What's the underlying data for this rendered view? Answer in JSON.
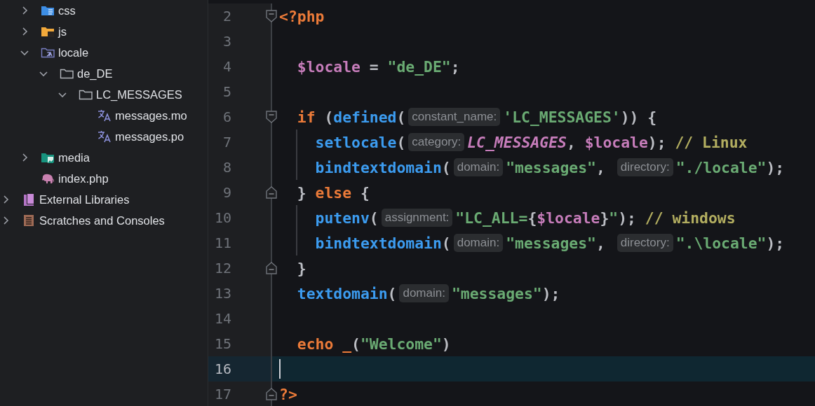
{
  "sidebar": {
    "project_items": [
      {
        "label": "css",
        "kind": "folder-css",
        "expanded": false
      },
      {
        "label": "js",
        "kind": "folder-js",
        "expanded": false
      },
      {
        "label": "locale",
        "kind": "folder-locale",
        "expanded": true,
        "children": [
          {
            "label": "de_DE",
            "kind": "folder",
            "expanded": true,
            "children": [
              {
                "label": "LC_MESSAGES",
                "kind": "folder",
                "expanded": true,
                "children": [
                  {
                    "label": "messages.mo",
                    "kind": "translation"
                  },
                  {
                    "label": "messages.po",
                    "kind": "translation"
                  }
                ]
              }
            ]
          }
        ]
      },
      {
        "label": "media",
        "kind": "folder-media",
        "expanded": false
      },
      {
        "label": "index.php",
        "kind": "php"
      }
    ],
    "roots": [
      {
        "label": "External Libraries",
        "kind": "libraries",
        "expanded": false
      },
      {
        "label": "Scratches and Consoles",
        "kind": "scratches",
        "expanded": false
      }
    ]
  },
  "editor": {
    "lines": [
      {
        "number": "2",
        "kind": "top",
        "fold_start": true,
        "fold_end": false,
        "current": false,
        "tokens": [
          {
            "kind": "keyword",
            "text": "<?php"
          }
        ]
      },
      {
        "number": "3",
        "kind": "top",
        "fold_start": false,
        "fold_end": false,
        "current": false
      },
      {
        "number": "4",
        "kind": "body",
        "fold_start": false,
        "fold_end": false,
        "current": false,
        "tokens": [
          {
            "kind": "variable",
            "text": "$locale"
          },
          {
            "kind": "punct",
            "text": " = "
          },
          {
            "kind": "string",
            "text": "\"de_DE\""
          },
          {
            "kind": "punct",
            "text": ";"
          }
        ]
      },
      {
        "number": "5",
        "kind": "top",
        "fold_start": false,
        "fold_end": false,
        "current": false
      },
      {
        "number": "6",
        "kind": "body",
        "fold_start": true,
        "fold_end": false,
        "current": false,
        "tokens": [
          {
            "kind": "keyword",
            "text": "if"
          },
          {
            "kind": "punct",
            "text": " ("
          },
          {
            "kind": "function",
            "text": "defined"
          },
          {
            "kind": "punct",
            "text": "("
          },
          {
            "kind": "hint",
            "text": "constant_name:"
          },
          {
            "kind": "string",
            "text": "'LC_MESSAGES'"
          },
          {
            "kind": "punct",
            "text": ")) {"
          }
        ]
      },
      {
        "number": "7",
        "kind": "block",
        "fold_start": false,
        "fold_end": false,
        "current": false,
        "tokens": [
          {
            "kind": "function",
            "text": "setlocale"
          },
          {
            "kind": "punct",
            "text": "("
          },
          {
            "kind": "hint",
            "text": "category:"
          },
          {
            "kind": "constant",
            "text": "LC_MESSAGES"
          },
          {
            "kind": "punct",
            "text": ", "
          },
          {
            "kind": "variable",
            "text": "$locale"
          },
          {
            "kind": "punct",
            "text": "); "
          },
          {
            "kind": "comment",
            "text": "// Linux"
          }
        ]
      },
      {
        "number": "8",
        "kind": "block",
        "fold_start": false,
        "fold_end": false,
        "current": false,
        "tokens": [
          {
            "kind": "function",
            "text": "bindtextdomain"
          },
          {
            "kind": "punct",
            "text": "("
          },
          {
            "kind": "hint",
            "text": "domain:"
          },
          {
            "kind": "string",
            "text": "\"messages\""
          },
          {
            "kind": "punct",
            "text": ", "
          },
          {
            "kind": "hint",
            "text": "directory:"
          },
          {
            "kind": "string",
            "text": "\"./locale\""
          },
          {
            "kind": "punct",
            "text": ");"
          }
        ]
      },
      {
        "number": "9",
        "kind": "body",
        "fold_start": false,
        "fold_end": true,
        "current": false,
        "tokens": [
          {
            "kind": "punct",
            "text": "} "
          },
          {
            "kind": "keyword",
            "text": "else"
          },
          {
            "kind": "punct",
            "text": " {"
          }
        ]
      },
      {
        "number": "10",
        "kind": "block",
        "fold_start": false,
        "fold_end": false,
        "current": false,
        "tokens": [
          {
            "kind": "function",
            "text": "putenv"
          },
          {
            "kind": "punct",
            "text": "("
          },
          {
            "kind": "hint",
            "text": "assignment:"
          },
          {
            "kind": "string",
            "text": "\"LC_ALL="
          },
          {
            "kind": "punct",
            "text": "{"
          },
          {
            "kind": "variable",
            "text": "$locale"
          },
          {
            "kind": "punct",
            "text": "}"
          },
          {
            "kind": "string",
            "text": "\""
          },
          {
            "kind": "punct",
            "text": "); "
          },
          {
            "kind": "comment",
            "text": "// windows"
          }
        ]
      },
      {
        "number": "11",
        "kind": "block",
        "fold_start": false,
        "fold_end": false,
        "current": false,
        "tokens": [
          {
            "kind": "function",
            "text": "bindtextdomain"
          },
          {
            "kind": "punct",
            "text": "("
          },
          {
            "kind": "hint",
            "text": "domain:"
          },
          {
            "kind": "string",
            "text": "\"messages\""
          },
          {
            "kind": "punct",
            "text": ", "
          },
          {
            "kind": "hint",
            "text": "directory:"
          },
          {
            "kind": "string",
            "text": "\".\\locale\""
          },
          {
            "kind": "punct",
            "text": ");"
          }
        ]
      },
      {
        "number": "12",
        "kind": "body",
        "fold_start": false,
        "fold_end": true,
        "current": false,
        "tokens": [
          {
            "kind": "punct",
            "text": "}"
          }
        ]
      },
      {
        "number": "13",
        "kind": "body",
        "fold_start": false,
        "fold_end": false,
        "current": false,
        "tokens": [
          {
            "kind": "function",
            "text": "textdomain"
          },
          {
            "kind": "punct",
            "text": "("
          },
          {
            "kind": "hint",
            "text": "domain:"
          },
          {
            "kind": "string",
            "text": "\"messages\""
          },
          {
            "kind": "punct",
            "text": ");"
          }
        ]
      },
      {
        "number": "14",
        "kind": "top",
        "fold_start": false,
        "fold_end": false,
        "current": false
      },
      {
        "number": "15",
        "kind": "body",
        "fold_start": false,
        "fold_end": false,
        "current": false,
        "tokens": [
          {
            "kind": "keyword",
            "text": "echo _"
          },
          {
            "kind": "punct",
            "text": "("
          },
          {
            "kind": "string",
            "text": "\"Welcome\""
          },
          {
            "kind": "punct",
            "text": ")"
          }
        ]
      },
      {
        "number": "16",
        "kind": "top",
        "fold_start": false,
        "fold_end": false,
        "current": true
      },
      {
        "number": "17",
        "kind": "top",
        "fold_start": false,
        "fold_end": true,
        "current": false,
        "tokens": [
          {
            "kind": "keyword",
            "text": "?>"
          }
        ]
      }
    ]
  }
}
